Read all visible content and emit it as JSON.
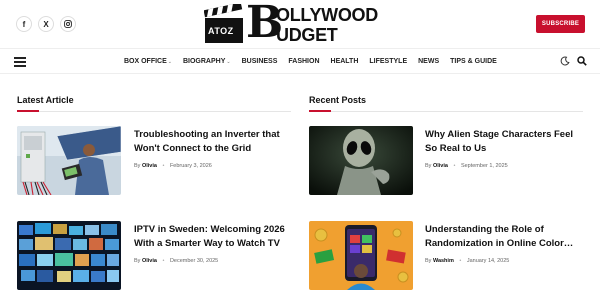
{
  "header": {
    "social": [
      "f",
      "X",
      "ig"
    ],
    "logo": {
      "badge_text": "ATOZ",
      "big_letter": "B",
      "line1": "OLLYWOOD",
      "line2": "UDGET"
    },
    "subscribe_label": "SUBSCRIBE"
  },
  "nav": {
    "items": [
      {
        "label": "BOX OFFICE",
        "has_dropdown": true
      },
      {
        "label": "BIOGRAPHY",
        "has_dropdown": true
      },
      {
        "label": "BUSINESS",
        "has_dropdown": false
      },
      {
        "label": "FASHION",
        "has_dropdown": false
      },
      {
        "label": "HEALTH",
        "has_dropdown": false
      },
      {
        "label": "LIFESTYLE",
        "has_dropdown": false
      },
      {
        "label": "NEWS",
        "has_dropdown": false
      },
      {
        "label": "TIPS & GUIDE",
        "has_dropdown": false
      }
    ],
    "caret": "⌄",
    "icons": [
      "menu-icon",
      "moon-icon",
      "search-icon"
    ]
  },
  "sections": {
    "latest": {
      "title": "Latest Article",
      "articles": [
        {
          "title": "Troubleshooting an Inverter that Won't Connect to the Grid",
          "by": "By",
          "author": "Olivia",
          "date": "February 3, 2026"
        },
        {
          "title": "IPTV in Sweden: Welcoming 2026 With a Smarter Way to Watch TV",
          "by": "By",
          "author": "Olivia",
          "date": "December 30, 2025"
        }
      ]
    },
    "recent": {
      "title": "Recent Posts",
      "articles": [
        {
          "title": "Why Alien Stage Characters Feel So Real to Us",
          "by": "By",
          "author": "Olivia",
          "date": "September 1, 2025"
        },
        {
          "title": "Understanding the Role of Randomization in Online Color…",
          "by": "By",
          "author": "Washim",
          "date": "January 14, 2025"
        }
      ]
    }
  },
  "colors": {
    "accent": "#c8102e",
    "text": "#111111",
    "meta": "#666666"
  }
}
